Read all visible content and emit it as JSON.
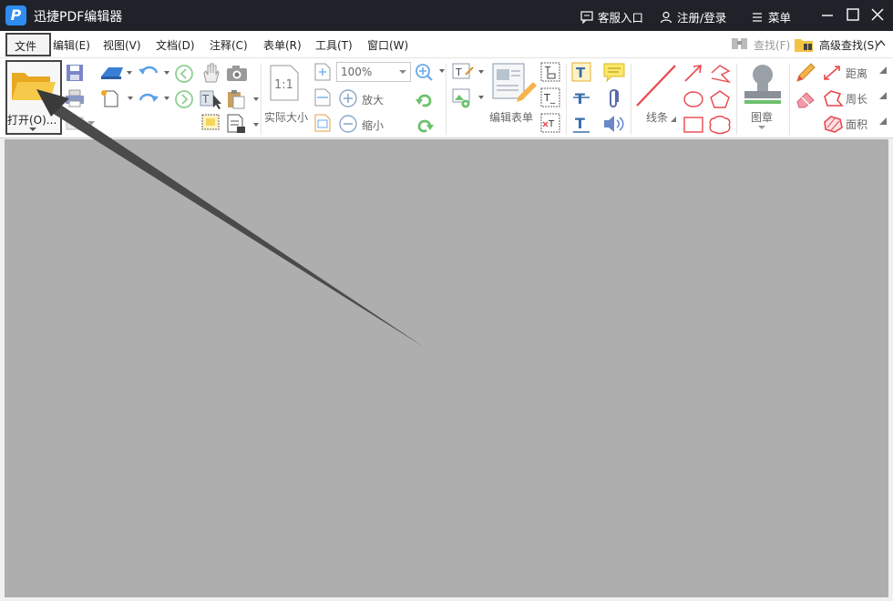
{
  "titlebar": {
    "app_title": "迅捷PDF编辑器",
    "logo_letter": "P",
    "customer_service": "客服入口",
    "register_login": "注册/登录",
    "menu": "菜单"
  },
  "menubar": {
    "items": [
      "文件",
      "编辑(E)",
      "视图(V)",
      "文档(D)",
      "注释(C)",
      "表单(R)",
      "工具(T)",
      "窗口(W)"
    ],
    "find": "查找(F)",
    "advanced_find": "高级查找(S)"
  },
  "ribbon": {
    "open": "打开(O)...",
    "actual_size": "实际大小",
    "zoom_value": "100%",
    "zoom_in": "放大",
    "zoom_out": "缩小",
    "edit_form": "编辑表单",
    "lines": "线条",
    "stamp": "图章",
    "distance": "距离",
    "perimeter": "周长",
    "area": "面积"
  },
  "colors": {
    "titlebar_bg": "#1f2329",
    "accent": "#2f8cf0",
    "workarea_bg": "#aeaeae",
    "annotation_red": "#e8474c"
  }
}
